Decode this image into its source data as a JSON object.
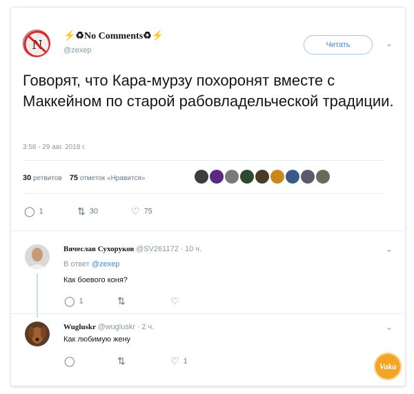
{
  "tweet": {
    "author_name": "⚡♻No Comments♻⚡",
    "handle": "@zexep",
    "follow_label": "Читать",
    "text": "Говорят, что Кара-мурзу похоронят вместе с Маккейном по старой рабовладельческой традиции.",
    "timestamp": "3:58 - 29 авг. 2018 г.",
    "retweets_count": "30",
    "retweets_label": "ретвитов",
    "likes_count": "75",
    "likes_label": "отметок «Нравится»",
    "reply_count": "1",
    "retweet_action_count": "30",
    "like_action_count": "75",
    "liker_colors": [
      "#3d3d3d",
      "#5a2a82",
      "#7a7a7a",
      "#2e4a2e",
      "#4a3a2a",
      "#c9881c",
      "#3a5a8a",
      "#5a5a6a",
      "#6a6a5a"
    ]
  },
  "replies": [
    {
      "name": "Вячеслав Сухоруков",
      "handle": "@SV261172",
      "time": "10 ч.",
      "reply_to_prefix": "В ответ",
      "reply_to_handle": "@zexep",
      "text": "Как боевого коня?",
      "reply_count": "1",
      "retweet_count": "",
      "like_count": ""
    },
    {
      "name": "Wugluskr",
      "handle": "@wugluskr",
      "time": "2 ч.",
      "text": "Как любимую жену",
      "reply_count": "",
      "retweet_count": "",
      "like_count": "1"
    }
  ],
  "watermark": "Vaka",
  "icons": {
    "reply": "reply-icon",
    "retweet": "retweet-icon",
    "like": "heart-icon",
    "caret": "chevron-down-icon"
  }
}
